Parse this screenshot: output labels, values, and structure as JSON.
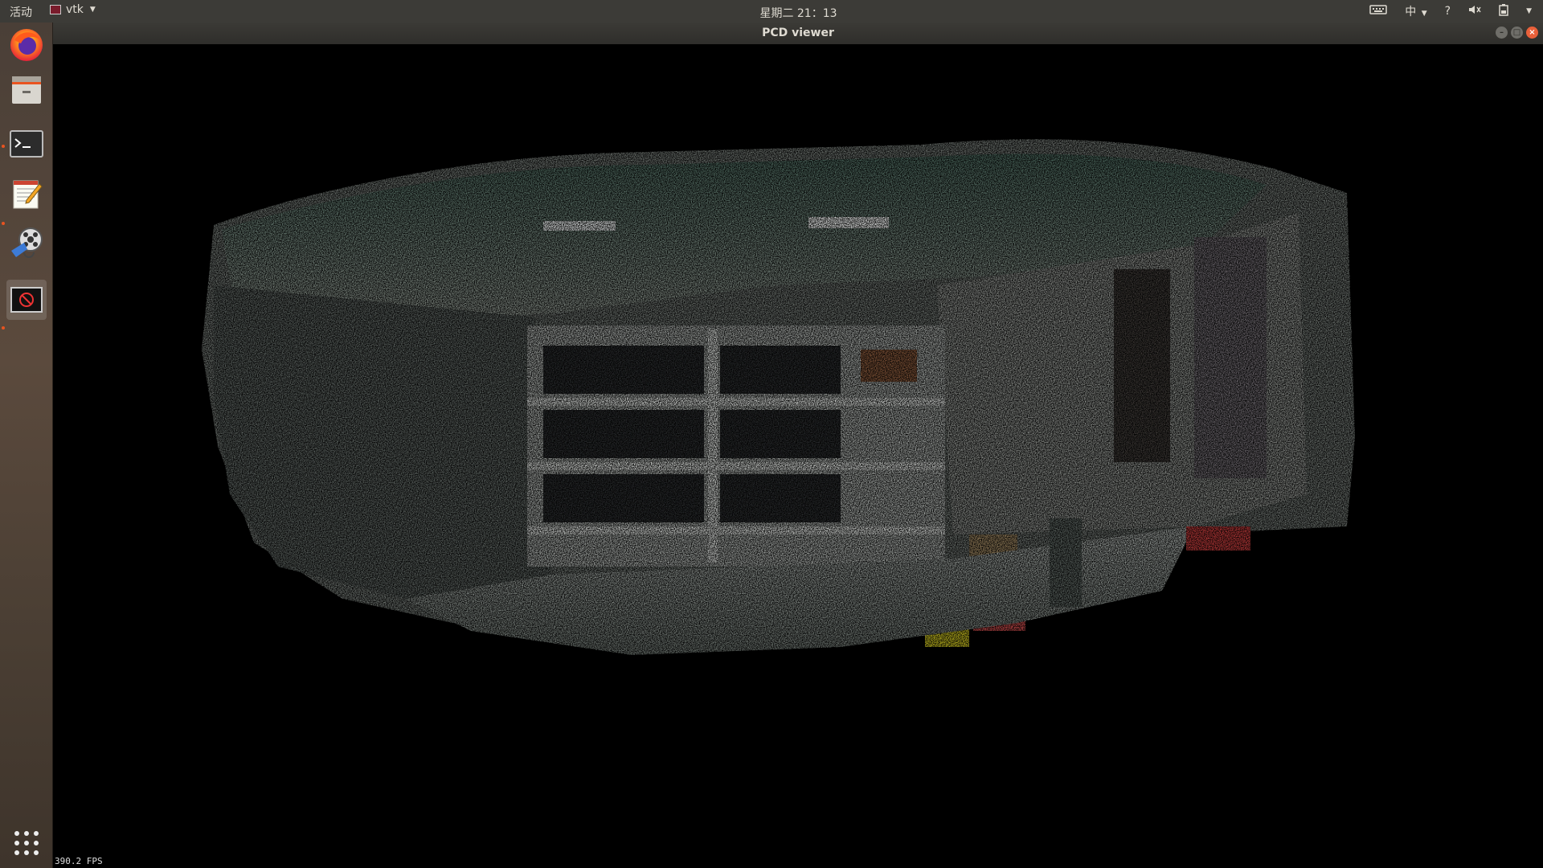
{
  "topbar": {
    "activities": "活动",
    "app_name": "vtk",
    "clock": "星期二 21：13",
    "input_method": "中",
    "help": "?"
  },
  "dock": {
    "items": [
      {
        "name": "firefox-icon"
      },
      {
        "name": "files-icon"
      },
      {
        "name": "terminal-icon"
      },
      {
        "name": "text-editor-icon"
      },
      {
        "name": "video-editor-icon"
      },
      {
        "name": "vtk-window-icon"
      },
      {
        "name": "show-applications-icon"
      }
    ]
  },
  "window": {
    "title": "PCD viewer",
    "fps": "390.2 FPS"
  },
  "colors": {
    "panel": "#3c3b37",
    "accent": "#e95420",
    "close": "#e9603a"
  }
}
